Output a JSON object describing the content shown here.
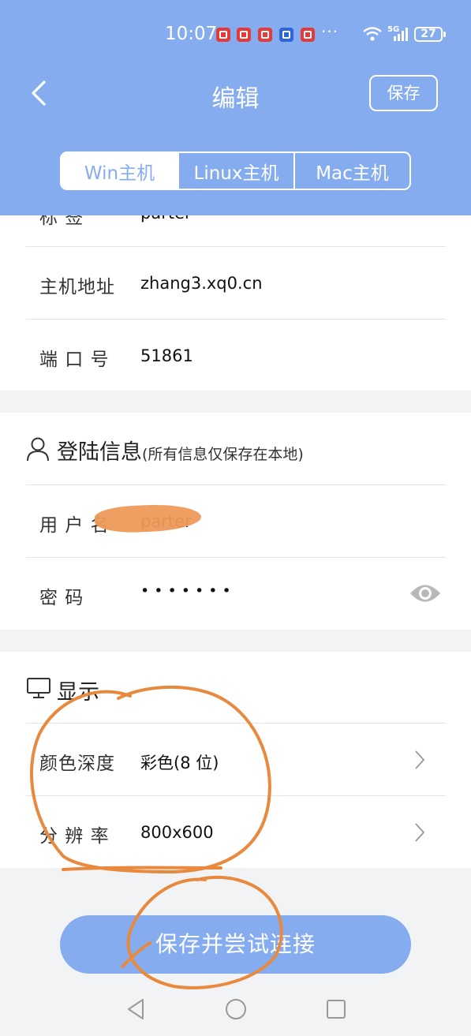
{
  "status_bar": {
    "time": "10:07",
    "more": "···",
    "network": "5G",
    "battery": "27"
  },
  "header": {
    "title": "编辑",
    "save_label": "保存"
  },
  "tabs": [
    {
      "label": "Win主机",
      "active": true
    },
    {
      "label": "Linux主机",
      "active": false
    },
    {
      "label": "Mac主机",
      "active": false
    }
  ],
  "host_section": {
    "partial_row": {
      "label": "标 签",
      "value": "parter"
    },
    "rows": [
      {
        "label": "主机地址",
        "value": "zhang3.xq0.cn"
      },
      {
        "label": "端 口 号",
        "value": "51861"
      }
    ]
  },
  "login_section": {
    "title": "登陆信息",
    "subtitle": "(所有信息仅保存在本地)",
    "rows": [
      {
        "label": "用 户 名",
        "value": "parter"
      },
      {
        "label": "密      码",
        "value": "• • • • • • •"
      }
    ]
  },
  "display_section": {
    "title": "显示",
    "rows": [
      {
        "label": "颜色深度",
        "value": "彩色(8 位)"
      },
      {
        "label": "分 辨 率",
        "value": "800x600"
      }
    ]
  },
  "connect_button": "保存并尝试连接",
  "colors": {
    "header_bg": "#86acf0",
    "annotation": "#e8893e"
  },
  "icons": [
    "back-arrow-icon",
    "user-icon",
    "monitor-icon",
    "eye-icon",
    "chevron-right-icon",
    "nav-back-icon",
    "nav-home-icon",
    "nav-recents-icon"
  ]
}
